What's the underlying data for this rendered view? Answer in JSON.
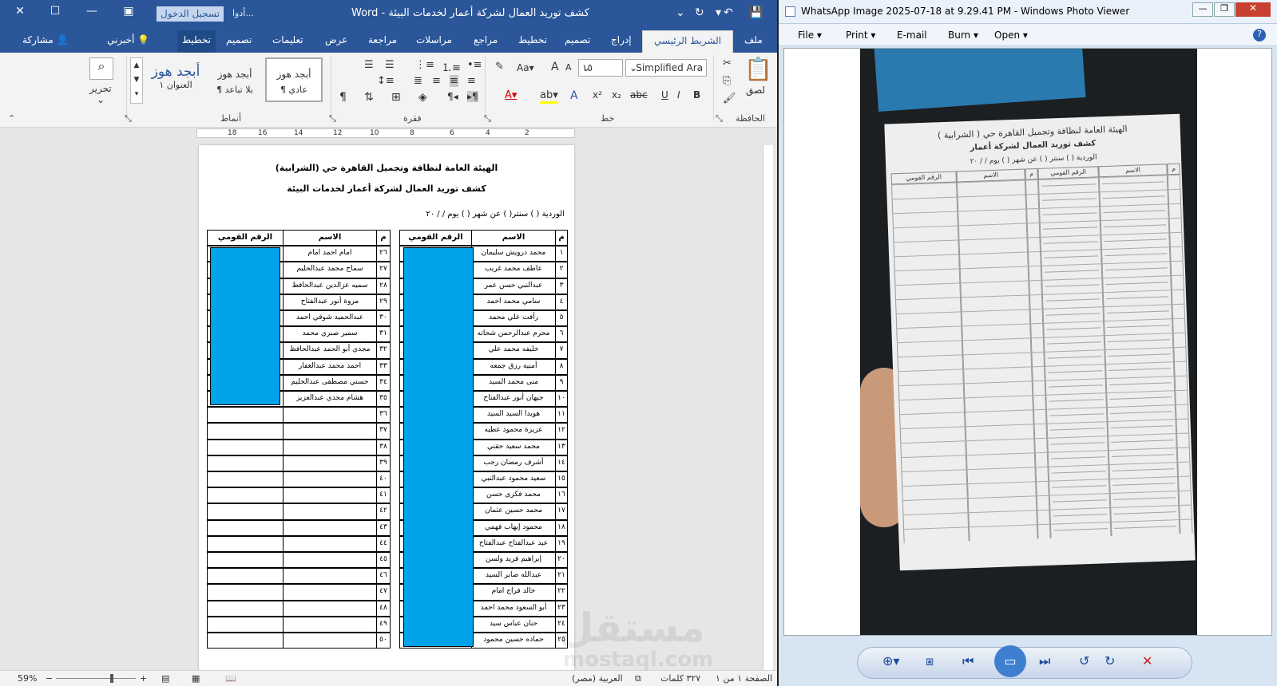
{
  "word": {
    "title": "كشف توريد العمال لشركة أعمار لخدمات البيئة - Word",
    "signin": "تسجيل الدخول",
    "tools": "أدوا...",
    "tabs": [
      "ملف",
      "الشريط الرئيسي",
      "إدراج",
      "تصميم",
      "تخطيط",
      "مراجع",
      "مراسلات",
      "مراجعة",
      "عرض",
      "تعليمات",
      "تصميم",
      "تخطيط",
      "أخبرني",
      "مشاركة"
    ],
    "ribbon": {
      "paste": "لصق",
      "clipboard": "الحافظة",
      "font": "خط",
      "paragraph": "فقرة",
      "styles": "أنماط",
      "editing": "تحرير",
      "font_name": "Simplified Ara",
      "font_size": "١٥",
      "style_normal": "¶ عادي",
      "style_nospacing": "¶ بلا تباعد",
      "style_h1": "العنوان ١",
      "style_sample": "أبجد هوز",
      "style_sample2": "أبجد هوز"
    },
    "ruler": [
      "2",
      "4",
      "6",
      "8",
      "10",
      "12",
      "14",
      "16",
      "18"
    ],
    "doc": {
      "h1": "الهيئة العامة لنظافة وتجميل القاهرة حي (الشرابية)",
      "h2": "كشف توريد العمال لشركة أعمار لخدمات البيئة",
      "line": "الوردية (         )        سنتر(          )        عن شهر (          )         يوم   /     /      ٢٠",
      "headers": {
        "m": "م",
        "name": "الاسم",
        "id": "الرقم القومي"
      },
      "right_rows": [
        [
          "١",
          "محمد درويش سليمان"
        ],
        [
          "٢",
          "عاطف محمد غريب"
        ],
        [
          "٣",
          "عبدالنبي حسن عمر"
        ],
        [
          "٤",
          "سامي محمد احمد"
        ],
        [
          "٥",
          "رأفت علي محمد"
        ],
        [
          "٦",
          "محرم عبدالرحمن شحاته"
        ],
        [
          "٧",
          "خليفه محمد علي"
        ],
        [
          "٨",
          "أمنية رزق جمعه"
        ],
        [
          "٩",
          "منى محمد السيد"
        ],
        [
          "١٠",
          "جيهان أنور عبدالفتاح"
        ],
        [
          "١١",
          "هويدا السيد السيد"
        ],
        [
          "١٢",
          "عزيزة محمود عطيه"
        ],
        [
          "١٣",
          "محمد سعيد حقني"
        ],
        [
          "١٤",
          "أشرف رمضان رجب"
        ],
        [
          "١٥",
          "سعيد محمود عبدالنبي"
        ],
        [
          "١٦",
          "محمد فكري حسن"
        ],
        [
          "١٧",
          "محمد حسين عثمان"
        ],
        [
          "١٨",
          "محمود إيهاب فهمي"
        ],
        [
          "١٩",
          "عيد عبدالفتاح عبدالفتاح"
        ],
        [
          "٢٠",
          "إبراهيم فريد ولسن"
        ],
        [
          "٢١",
          "عبدالله صابر السيد"
        ],
        [
          "٢٢",
          "خالد فراج امام"
        ],
        [
          "٢٣",
          "أبو السعود محمد احمد"
        ],
        [
          "٢٤",
          "حنان عباس سيد"
        ],
        [
          "٢٥",
          "حماده حسين محمود"
        ]
      ],
      "left_rows": [
        [
          "٢٦",
          "امام احمد امام"
        ],
        [
          "٢٧",
          "سماح محمد عبدالحليم"
        ],
        [
          "٢٨",
          "سميه عزالدين عبدالحافظ"
        ],
        [
          "٢٩",
          "مروة أنور عبدالفتاح"
        ],
        [
          "٣٠",
          "عبدالحميد شوقي احمد"
        ],
        [
          "٣١",
          "سمير صبري محمد"
        ],
        [
          "٣٢",
          "مجدي أبو الحمد عبدالحافظ"
        ],
        [
          "٣٣",
          "احمد محمد عبدالغفار"
        ],
        [
          "٣٤",
          "حسني مصطفى عبدالحليم"
        ],
        [
          "٣٥",
          "هشام مجدي عبدالعزيز"
        ],
        [
          "٣٦",
          ""
        ],
        [
          "٣٧",
          ""
        ],
        [
          "٣٨",
          ""
        ],
        [
          "٣٩",
          ""
        ],
        [
          "٤٠",
          ""
        ],
        [
          "٤١",
          ""
        ],
        [
          "٤٢",
          ""
        ],
        [
          "٤٣",
          ""
        ],
        [
          "٤٤",
          ""
        ],
        [
          "٤٥",
          ""
        ],
        [
          "٤٦",
          ""
        ],
        [
          "٤٧",
          ""
        ],
        [
          "٤٨",
          ""
        ],
        [
          "٤٩",
          ""
        ],
        [
          "٥٠",
          ""
        ]
      ]
    },
    "status": {
      "page": "الصفحة ١ من ١",
      "words": "٣٢٧ كلمات",
      "lang": "العربية (مصر)",
      "zoom": "59%"
    }
  },
  "viewer": {
    "title": "WhatsApp Image 2025-07-18 at 9.29.41 PM - Windows Photo Viewer",
    "menu": [
      "File",
      "Print",
      "E-mail",
      "Burn",
      "Open"
    ],
    "sheet": {
      "h1": "الهيئة العامة لنظافة وتجميل القاهرة حي ( الشرابية )",
      "h2": "كشف توريد العمال لشركة أعمار",
      "line": "الوردية (        )   سنتر (      )   عن شهر (      )   يوم   /   /   ٢٠",
      "cols": [
        "م",
        "الاسم",
        "الرقم القومي",
        "م",
        "الاسم",
        "الرقم القومي"
      ]
    }
  },
  "watermark": {
    "ar": "مستقل",
    "en": "mostaql.com"
  },
  "colors": {
    "word_blue": "#2b579a",
    "cell_fill": "#00a2e8"
  }
}
